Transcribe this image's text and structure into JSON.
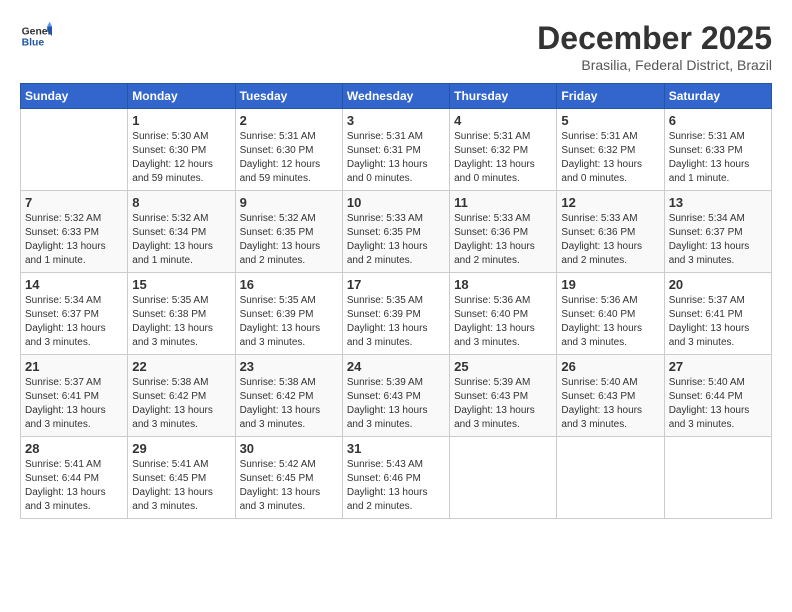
{
  "logo": {
    "general": "General",
    "blue": "Blue"
  },
  "title": "December 2025",
  "subtitle": "Brasilia, Federal District, Brazil",
  "headers": [
    "Sunday",
    "Monday",
    "Tuesday",
    "Wednesday",
    "Thursday",
    "Friday",
    "Saturday"
  ],
  "weeks": [
    [
      {
        "day": "",
        "info": ""
      },
      {
        "day": "1",
        "info": "Sunrise: 5:30 AM\nSunset: 6:30 PM\nDaylight: 12 hours\nand 59 minutes."
      },
      {
        "day": "2",
        "info": "Sunrise: 5:31 AM\nSunset: 6:30 PM\nDaylight: 12 hours\nand 59 minutes."
      },
      {
        "day": "3",
        "info": "Sunrise: 5:31 AM\nSunset: 6:31 PM\nDaylight: 13 hours\nand 0 minutes."
      },
      {
        "day": "4",
        "info": "Sunrise: 5:31 AM\nSunset: 6:32 PM\nDaylight: 13 hours\nand 0 minutes."
      },
      {
        "day": "5",
        "info": "Sunrise: 5:31 AM\nSunset: 6:32 PM\nDaylight: 13 hours\nand 0 minutes."
      },
      {
        "day": "6",
        "info": "Sunrise: 5:31 AM\nSunset: 6:33 PM\nDaylight: 13 hours\nand 1 minute."
      }
    ],
    [
      {
        "day": "7",
        "info": "Sunrise: 5:32 AM\nSunset: 6:33 PM\nDaylight: 13 hours\nand 1 minute."
      },
      {
        "day": "8",
        "info": "Sunrise: 5:32 AM\nSunset: 6:34 PM\nDaylight: 13 hours\nand 1 minute."
      },
      {
        "day": "9",
        "info": "Sunrise: 5:32 AM\nSunset: 6:35 PM\nDaylight: 13 hours\nand 2 minutes."
      },
      {
        "day": "10",
        "info": "Sunrise: 5:33 AM\nSunset: 6:35 PM\nDaylight: 13 hours\nand 2 minutes."
      },
      {
        "day": "11",
        "info": "Sunrise: 5:33 AM\nSunset: 6:36 PM\nDaylight: 13 hours\nand 2 minutes."
      },
      {
        "day": "12",
        "info": "Sunrise: 5:33 AM\nSunset: 6:36 PM\nDaylight: 13 hours\nand 2 minutes."
      },
      {
        "day": "13",
        "info": "Sunrise: 5:34 AM\nSunset: 6:37 PM\nDaylight: 13 hours\nand 3 minutes."
      }
    ],
    [
      {
        "day": "14",
        "info": "Sunrise: 5:34 AM\nSunset: 6:37 PM\nDaylight: 13 hours\nand 3 minutes."
      },
      {
        "day": "15",
        "info": "Sunrise: 5:35 AM\nSunset: 6:38 PM\nDaylight: 13 hours\nand 3 minutes."
      },
      {
        "day": "16",
        "info": "Sunrise: 5:35 AM\nSunset: 6:39 PM\nDaylight: 13 hours\nand 3 minutes."
      },
      {
        "day": "17",
        "info": "Sunrise: 5:35 AM\nSunset: 6:39 PM\nDaylight: 13 hours\nand 3 minutes."
      },
      {
        "day": "18",
        "info": "Sunrise: 5:36 AM\nSunset: 6:40 PM\nDaylight: 13 hours\nand 3 minutes."
      },
      {
        "day": "19",
        "info": "Sunrise: 5:36 AM\nSunset: 6:40 PM\nDaylight: 13 hours\nand 3 minutes."
      },
      {
        "day": "20",
        "info": "Sunrise: 5:37 AM\nSunset: 6:41 PM\nDaylight: 13 hours\nand 3 minutes."
      }
    ],
    [
      {
        "day": "21",
        "info": "Sunrise: 5:37 AM\nSunset: 6:41 PM\nDaylight: 13 hours\nand 3 minutes."
      },
      {
        "day": "22",
        "info": "Sunrise: 5:38 AM\nSunset: 6:42 PM\nDaylight: 13 hours\nand 3 minutes."
      },
      {
        "day": "23",
        "info": "Sunrise: 5:38 AM\nSunset: 6:42 PM\nDaylight: 13 hours\nand 3 minutes."
      },
      {
        "day": "24",
        "info": "Sunrise: 5:39 AM\nSunset: 6:43 PM\nDaylight: 13 hours\nand 3 minutes."
      },
      {
        "day": "25",
        "info": "Sunrise: 5:39 AM\nSunset: 6:43 PM\nDaylight: 13 hours\nand 3 minutes."
      },
      {
        "day": "26",
        "info": "Sunrise: 5:40 AM\nSunset: 6:43 PM\nDaylight: 13 hours\nand 3 minutes."
      },
      {
        "day": "27",
        "info": "Sunrise: 5:40 AM\nSunset: 6:44 PM\nDaylight: 13 hours\nand 3 minutes."
      }
    ],
    [
      {
        "day": "28",
        "info": "Sunrise: 5:41 AM\nSunset: 6:44 PM\nDaylight: 13 hours\nand 3 minutes."
      },
      {
        "day": "29",
        "info": "Sunrise: 5:41 AM\nSunset: 6:45 PM\nDaylight: 13 hours\nand 3 minutes."
      },
      {
        "day": "30",
        "info": "Sunrise: 5:42 AM\nSunset: 6:45 PM\nDaylight: 13 hours\nand 3 minutes."
      },
      {
        "day": "31",
        "info": "Sunrise: 5:43 AM\nSunset: 6:46 PM\nDaylight: 13 hours\nand 2 minutes."
      },
      {
        "day": "",
        "info": ""
      },
      {
        "day": "",
        "info": ""
      },
      {
        "day": "",
        "info": ""
      }
    ]
  ]
}
